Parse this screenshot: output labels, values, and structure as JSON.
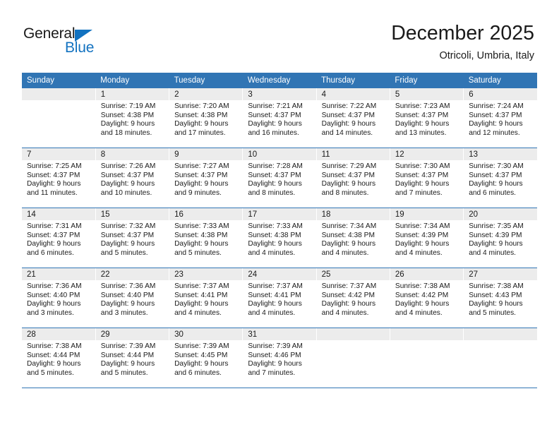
{
  "brand": {
    "name_part1": "General",
    "name_part2": "Blue",
    "triangle_color": "#1272c0"
  },
  "header": {
    "month_title": "December 2025",
    "location": "Otricoli, Umbria, Italy"
  },
  "theme": {
    "header_row_bg": "#3175b4",
    "daynum_band_bg": "#ececec",
    "grid_line": "#3175b4",
    "text": "#1a1a1a"
  },
  "weekdays": [
    "Sunday",
    "Monday",
    "Tuesday",
    "Wednesday",
    "Thursday",
    "Friday",
    "Saturday"
  ],
  "labels": {
    "sunrise_prefix": "Sunrise:",
    "sunset_prefix": "Sunset:",
    "daylight_prefix": "Daylight:"
  },
  "weeks": [
    [
      {
        "day": "",
        "empty": true
      },
      {
        "day": "1",
        "sunrise": "Sunrise: 7:19 AM",
        "sunset": "Sunset: 4:38 PM",
        "daylight_l1": "Daylight: 9 hours",
        "daylight_l2": "and 18 minutes."
      },
      {
        "day": "2",
        "sunrise": "Sunrise: 7:20 AM",
        "sunset": "Sunset: 4:38 PM",
        "daylight_l1": "Daylight: 9 hours",
        "daylight_l2": "and 17 minutes."
      },
      {
        "day": "3",
        "sunrise": "Sunrise: 7:21 AM",
        "sunset": "Sunset: 4:37 PM",
        "daylight_l1": "Daylight: 9 hours",
        "daylight_l2": "and 16 minutes."
      },
      {
        "day": "4",
        "sunrise": "Sunrise: 7:22 AM",
        "sunset": "Sunset: 4:37 PM",
        "daylight_l1": "Daylight: 9 hours",
        "daylight_l2": "and 14 minutes."
      },
      {
        "day": "5",
        "sunrise": "Sunrise: 7:23 AM",
        "sunset": "Sunset: 4:37 PM",
        "daylight_l1": "Daylight: 9 hours",
        "daylight_l2": "and 13 minutes."
      },
      {
        "day": "6",
        "sunrise": "Sunrise: 7:24 AM",
        "sunset": "Sunset: 4:37 PM",
        "daylight_l1": "Daylight: 9 hours",
        "daylight_l2": "and 12 minutes."
      }
    ],
    [
      {
        "day": "7",
        "sunrise": "Sunrise: 7:25 AM",
        "sunset": "Sunset: 4:37 PM",
        "daylight_l1": "Daylight: 9 hours",
        "daylight_l2": "and 11 minutes."
      },
      {
        "day": "8",
        "sunrise": "Sunrise: 7:26 AM",
        "sunset": "Sunset: 4:37 PM",
        "daylight_l1": "Daylight: 9 hours",
        "daylight_l2": "and 10 minutes."
      },
      {
        "day": "9",
        "sunrise": "Sunrise: 7:27 AM",
        "sunset": "Sunset: 4:37 PM",
        "daylight_l1": "Daylight: 9 hours",
        "daylight_l2": "and 9 minutes."
      },
      {
        "day": "10",
        "sunrise": "Sunrise: 7:28 AM",
        "sunset": "Sunset: 4:37 PM",
        "daylight_l1": "Daylight: 9 hours",
        "daylight_l2": "and 8 minutes."
      },
      {
        "day": "11",
        "sunrise": "Sunrise: 7:29 AM",
        "sunset": "Sunset: 4:37 PM",
        "daylight_l1": "Daylight: 9 hours",
        "daylight_l2": "and 8 minutes."
      },
      {
        "day": "12",
        "sunrise": "Sunrise: 7:30 AM",
        "sunset": "Sunset: 4:37 PM",
        "daylight_l1": "Daylight: 9 hours",
        "daylight_l2": "and 7 minutes."
      },
      {
        "day": "13",
        "sunrise": "Sunrise: 7:30 AM",
        "sunset": "Sunset: 4:37 PM",
        "daylight_l1": "Daylight: 9 hours",
        "daylight_l2": "and 6 minutes."
      }
    ],
    [
      {
        "day": "14",
        "sunrise": "Sunrise: 7:31 AM",
        "sunset": "Sunset: 4:37 PM",
        "daylight_l1": "Daylight: 9 hours",
        "daylight_l2": "and 6 minutes."
      },
      {
        "day": "15",
        "sunrise": "Sunrise: 7:32 AM",
        "sunset": "Sunset: 4:37 PM",
        "daylight_l1": "Daylight: 9 hours",
        "daylight_l2": "and 5 minutes."
      },
      {
        "day": "16",
        "sunrise": "Sunrise: 7:33 AM",
        "sunset": "Sunset: 4:38 PM",
        "daylight_l1": "Daylight: 9 hours",
        "daylight_l2": "and 5 minutes."
      },
      {
        "day": "17",
        "sunrise": "Sunrise: 7:33 AM",
        "sunset": "Sunset: 4:38 PM",
        "daylight_l1": "Daylight: 9 hours",
        "daylight_l2": "and 4 minutes."
      },
      {
        "day": "18",
        "sunrise": "Sunrise: 7:34 AM",
        "sunset": "Sunset: 4:38 PM",
        "daylight_l1": "Daylight: 9 hours",
        "daylight_l2": "and 4 minutes."
      },
      {
        "day": "19",
        "sunrise": "Sunrise: 7:34 AM",
        "sunset": "Sunset: 4:39 PM",
        "daylight_l1": "Daylight: 9 hours",
        "daylight_l2": "and 4 minutes."
      },
      {
        "day": "20",
        "sunrise": "Sunrise: 7:35 AM",
        "sunset": "Sunset: 4:39 PM",
        "daylight_l1": "Daylight: 9 hours",
        "daylight_l2": "and 4 minutes."
      }
    ],
    [
      {
        "day": "21",
        "sunrise": "Sunrise: 7:36 AM",
        "sunset": "Sunset: 4:40 PM",
        "daylight_l1": "Daylight: 9 hours",
        "daylight_l2": "and 3 minutes."
      },
      {
        "day": "22",
        "sunrise": "Sunrise: 7:36 AM",
        "sunset": "Sunset: 4:40 PM",
        "daylight_l1": "Daylight: 9 hours",
        "daylight_l2": "and 3 minutes."
      },
      {
        "day": "23",
        "sunrise": "Sunrise: 7:37 AM",
        "sunset": "Sunset: 4:41 PM",
        "daylight_l1": "Daylight: 9 hours",
        "daylight_l2": "and 4 minutes."
      },
      {
        "day": "24",
        "sunrise": "Sunrise: 7:37 AM",
        "sunset": "Sunset: 4:41 PM",
        "daylight_l1": "Daylight: 9 hours",
        "daylight_l2": "and 4 minutes."
      },
      {
        "day": "25",
        "sunrise": "Sunrise: 7:37 AM",
        "sunset": "Sunset: 4:42 PM",
        "daylight_l1": "Daylight: 9 hours",
        "daylight_l2": "and 4 minutes."
      },
      {
        "day": "26",
        "sunrise": "Sunrise: 7:38 AM",
        "sunset": "Sunset: 4:42 PM",
        "daylight_l1": "Daylight: 9 hours",
        "daylight_l2": "and 4 minutes."
      },
      {
        "day": "27",
        "sunrise": "Sunrise: 7:38 AM",
        "sunset": "Sunset: 4:43 PM",
        "daylight_l1": "Daylight: 9 hours",
        "daylight_l2": "and 5 minutes."
      }
    ],
    [
      {
        "day": "28",
        "sunrise": "Sunrise: 7:38 AM",
        "sunset": "Sunset: 4:44 PM",
        "daylight_l1": "Daylight: 9 hours",
        "daylight_l2": "and 5 minutes."
      },
      {
        "day": "29",
        "sunrise": "Sunrise: 7:39 AM",
        "sunset": "Sunset: 4:44 PM",
        "daylight_l1": "Daylight: 9 hours",
        "daylight_l2": "and 5 minutes."
      },
      {
        "day": "30",
        "sunrise": "Sunrise: 7:39 AM",
        "sunset": "Sunset: 4:45 PM",
        "daylight_l1": "Daylight: 9 hours",
        "daylight_l2": "and 6 minutes."
      },
      {
        "day": "31",
        "sunrise": "Sunrise: 7:39 AM",
        "sunset": "Sunset: 4:46 PM",
        "daylight_l1": "Daylight: 9 hours",
        "daylight_l2": "and 7 minutes."
      },
      {
        "day": "",
        "empty": true
      },
      {
        "day": "",
        "empty": true
      },
      {
        "day": "",
        "empty": true
      }
    ]
  ]
}
